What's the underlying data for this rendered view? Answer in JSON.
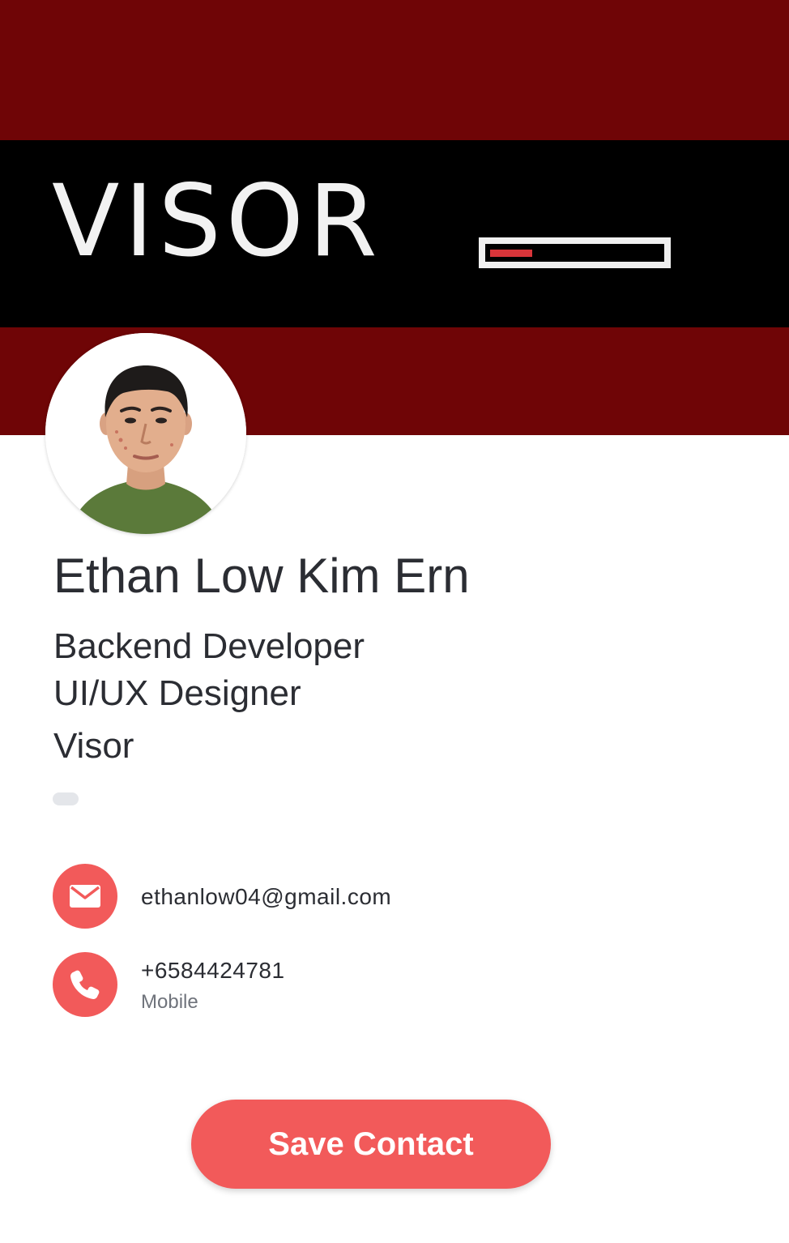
{
  "cover": {
    "brand_logo_text": "VISOR",
    "background_color": "#6f0506",
    "band_color": "#000000"
  },
  "profile": {
    "name": "Ethan Low Kim Ern",
    "job_titles": [
      "Backend Developer",
      "UI/UX Designer"
    ],
    "company": "Visor"
  },
  "contacts": {
    "email": {
      "icon": "envelope-icon",
      "value": "ethanlow04@gmail.com"
    },
    "phone": {
      "icon": "phone-icon",
      "value": "+6584424781",
      "label": "Mobile"
    }
  },
  "actions": {
    "save_label": "Save Contact"
  },
  "colors": {
    "accent": "#f25a5a",
    "text": "#2b2d33",
    "muted": "#6f737b"
  }
}
